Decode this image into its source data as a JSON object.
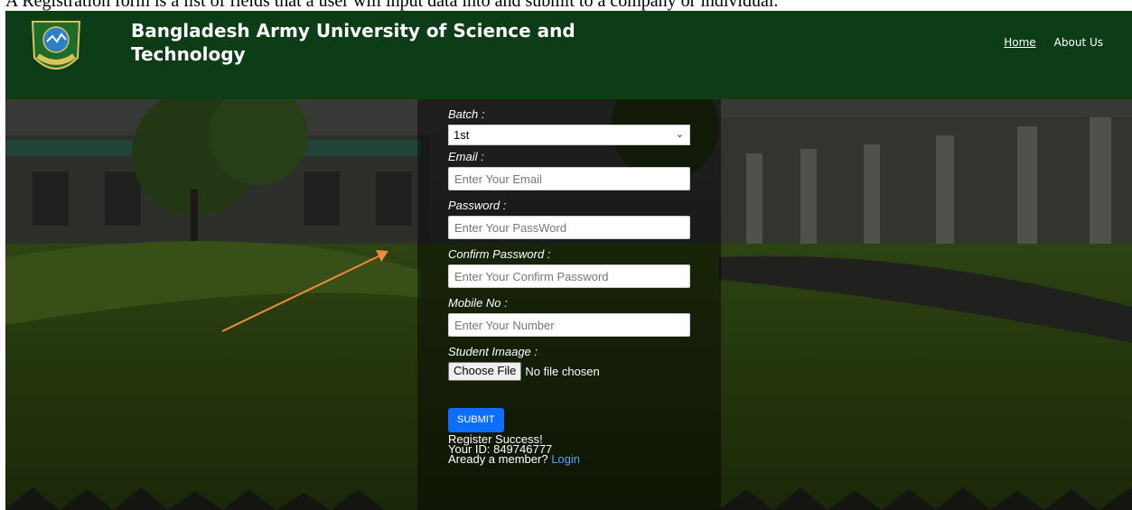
{
  "caption": "A Registration form is a list of fields that a user will input data into and submit to a company or individual.",
  "header": {
    "title": "Bangladesh Army University of Science and Technology",
    "title_line1": "Bangladesh Army University of Science and",
    "title_line2": "Technology",
    "logo_text": "BAUST",
    "nav": [
      {
        "label": "Home",
        "active": true
      },
      {
        "label": "About Us",
        "active": false
      }
    ]
  },
  "form": {
    "batch_label": "Batch :",
    "batch_value": "1st",
    "email_label": "Email :",
    "email_placeholder": "Enter Your Email",
    "password_label": "Password :",
    "password_placeholder": "Enter Your PassWord",
    "confirm_label": "Confirm Password :",
    "confirm_placeholder": "Enter Your Confirm Password",
    "mobile_label": "Mobile No :",
    "mobile_placeholder": "Enter Your Number",
    "image_label": "Student Imaage :",
    "file_button": "Choose File",
    "file_status": "No file chosen",
    "submit": "SUBMIT",
    "success": "Register Success!",
    "your_id": "Your ID: 849746777",
    "member_text": "Aready a member?",
    "login": "Login"
  },
  "colors": {
    "navbar": "#0d3d17",
    "submit": "#0d6efd",
    "arrow": "#f08a3c",
    "link": "#4ea3ff"
  }
}
